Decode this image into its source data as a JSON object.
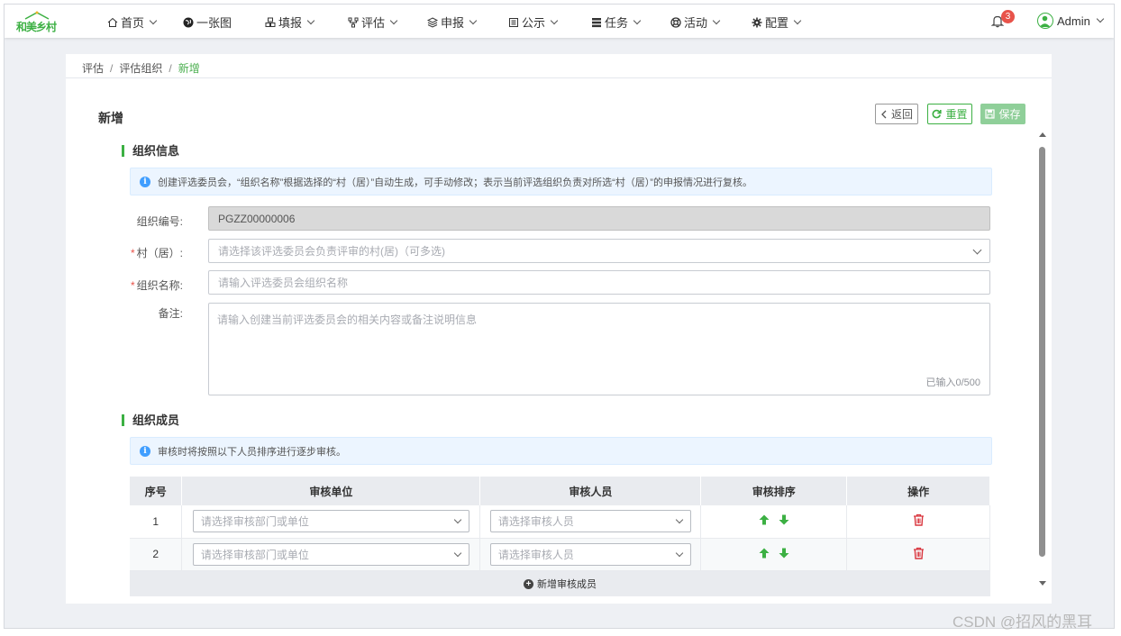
{
  "app": {
    "logo_text": "和美乡村"
  },
  "nav": {
    "items": [
      {
        "label": "首页",
        "icon": "home-icon",
        "dropdown": true
      },
      {
        "label": "一张图",
        "icon": "globe-icon",
        "dropdown": false
      },
      {
        "label": "填报",
        "icon": "boxes-icon",
        "dropdown": true
      },
      {
        "label": "评估",
        "icon": "network-icon",
        "dropdown": true
      },
      {
        "label": "申报",
        "icon": "layers-icon",
        "dropdown": true
      },
      {
        "label": "公示",
        "icon": "board-icon",
        "dropdown": true
      },
      {
        "label": "任务",
        "icon": "list-icon",
        "dropdown": true
      },
      {
        "label": "活动",
        "icon": "lifebuoy-icon",
        "dropdown": true
      },
      {
        "label": "配置",
        "icon": "gear-icon",
        "dropdown": true
      }
    ],
    "notification_count": "3",
    "user_name": "Admin"
  },
  "breadcrumb": [
    "评估",
    "评估组织",
    "新增"
  ],
  "page": {
    "title": "新增",
    "back_label": "返回",
    "reset_label": "重置",
    "save_label": "保存"
  },
  "org_info": {
    "section_title": "组织信息",
    "notice": "创建评选委员会，“组织名称”根据选择的“村（居）”自动生成，可手动修改；表示当前评选组织负责对所选“村（居）”的申报情况进行复核。",
    "code_label": "组织编号:",
    "code_value": "PGZZ00000006",
    "village_label": "村（居）:",
    "village_placeholder": "请选择该评选委员会负责评审的村(居)（可多选)",
    "name_label": "组织名称:",
    "name_placeholder": "请输入评选委员会组织名称",
    "remark_label": "备注:",
    "remark_placeholder": "请输入创建当前评选委员会的相关内容或备注说明信息",
    "remark_counter": "已输入0/500"
  },
  "members": {
    "section_title": "组织成员",
    "notice": "审核时将按照以下人员排序进行逐步审核。",
    "columns": [
      "序号",
      "审核单位",
      "审核人员",
      "审核排序",
      "操作"
    ],
    "rows": [
      {
        "index": "1",
        "unit_placeholder": "请选择审核部门或单位",
        "person_placeholder": "请选择审核人员"
      },
      {
        "index": "2",
        "unit_placeholder": "请选择审核部门或单位",
        "person_placeholder": "请选择审核人员"
      }
    ],
    "add_label": "新增审核成员"
  },
  "watermark": "CSDN @招风的黑耳",
  "colors": {
    "accent": "#3cb043",
    "danger": "#e8534a",
    "info": "#409eff"
  }
}
